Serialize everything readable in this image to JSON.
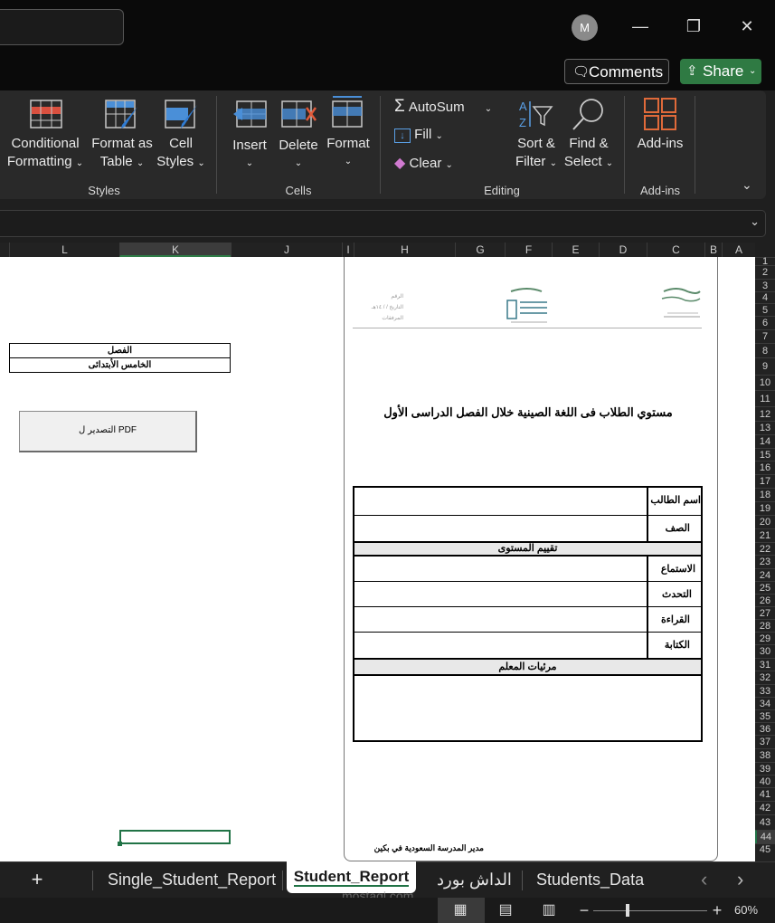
{
  "titlebar": {
    "avatar_initial": "M",
    "minimize": "—",
    "restore": "❐",
    "close": "✕"
  },
  "actions": {
    "comments": "Comments",
    "share": "Share"
  },
  "ribbon": {
    "styles": {
      "conditional_formatting": [
        "Conditional",
        "Formatting"
      ],
      "format_as_table": [
        "Format as",
        "Table"
      ],
      "cell_styles": [
        "Cell",
        "Styles"
      ],
      "group": "Styles"
    },
    "cells": {
      "insert": "Insert",
      "delete": "Delete",
      "format": "Format",
      "group": "Cells"
    },
    "editing": {
      "autosum": "AutoSum",
      "fill": "Fill",
      "clear": "Clear",
      "sort_filter": [
        "Sort &",
        "Filter"
      ],
      "find_select": [
        "Find &",
        "Select"
      ],
      "group": "Editing"
    },
    "addins": {
      "addins": "Add-ins",
      "group": "Add-ins"
    }
  },
  "columns": [
    "L",
    "K",
    "J",
    "I",
    "H",
    "G",
    "F",
    "E",
    "D",
    "C",
    "B",
    "A"
  ],
  "rows": [
    "1",
    "2",
    "3",
    "4",
    "5",
    "6",
    "7",
    "8",
    "9",
    "10",
    "11",
    "12",
    "13",
    "14",
    "15",
    "16",
    "17",
    "18",
    "19",
    "20",
    "21",
    "22",
    "23",
    "24",
    "25",
    "26",
    "27",
    "28",
    "29",
    "30",
    "31",
    "32",
    "33",
    "34",
    "35",
    "36",
    "37",
    "38",
    "39",
    "40",
    "41",
    "42",
    "43",
    "44",
    "45"
  ],
  "sheet": {
    "class_header": "الفصل",
    "class_value": "الخامس الأبتدائى",
    "export_button": "التصدير ل PDF",
    "report_title": "مستوي الطلاب فى اللغة الصينية خلال الفصل الدراسى الأول",
    "student_name_label": "اسم الطالب",
    "grade_label": "الصف",
    "level_eval_header": "تقييم المستوى",
    "listening": "الاستماع",
    "speaking": "التحدث",
    "reading": "القراءة",
    "writing": "الكتابة",
    "teacher_notes_header": "مرئيات المعلم",
    "principal": "مدير المدرسة السعودية في بكين",
    "letterhead_fields": [
      "الرقم",
      "التاريخ  /  / ١٤هـ",
      "المرفقات"
    ]
  },
  "tabs": {
    "add": "+",
    "single": "Single_Student_Report",
    "student": "Student_Report",
    "dashboard": "الداش بورد",
    "students_data": "Students_Data",
    "prev": "‹",
    "next": "›"
  },
  "status": {
    "zoom": "60%",
    "minus": "−",
    "plus": "+"
  },
  "watermark": "mostaql.com"
}
